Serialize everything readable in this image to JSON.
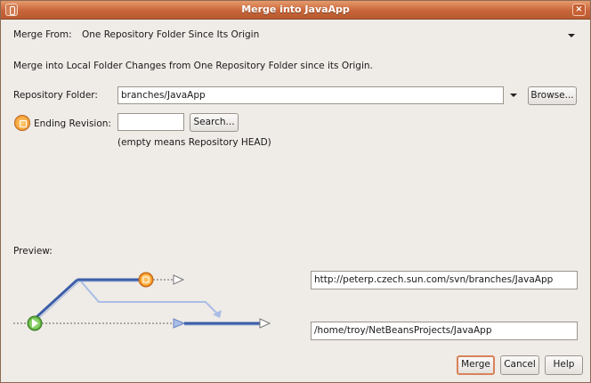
{
  "window": {
    "title": "Merge into JavaApp"
  },
  "merge_from": {
    "label": "Merge From:",
    "value": "One Repository Folder Since Its Origin"
  },
  "description": "Merge into Local Folder Changes from One Repository Folder since its Origin.",
  "repository_folder": {
    "label": "Repository Folder:",
    "value": "branches/JavaApp",
    "browse_label": "Browse..."
  },
  "ending_revision": {
    "label": "Ending Revision:",
    "value": "",
    "search_label": "Search...",
    "hint": "(empty means Repository HEAD)"
  },
  "preview": {
    "label": "Preview:",
    "remote_url": "http://peterp.czech.sun.com/svn/branches/JavaApp",
    "local_path": "/home/troy/NetBeansProjects/JavaApp"
  },
  "buttons": {
    "merge": "Merge",
    "cancel": "Cancel",
    "help": "Help"
  },
  "colors": {
    "titlebar": "#c8653a",
    "accent": "#d8825a",
    "branch_line": "#3c5ea8",
    "revision_marker": "#f08a1c",
    "origin_marker": "#5cae3c"
  }
}
